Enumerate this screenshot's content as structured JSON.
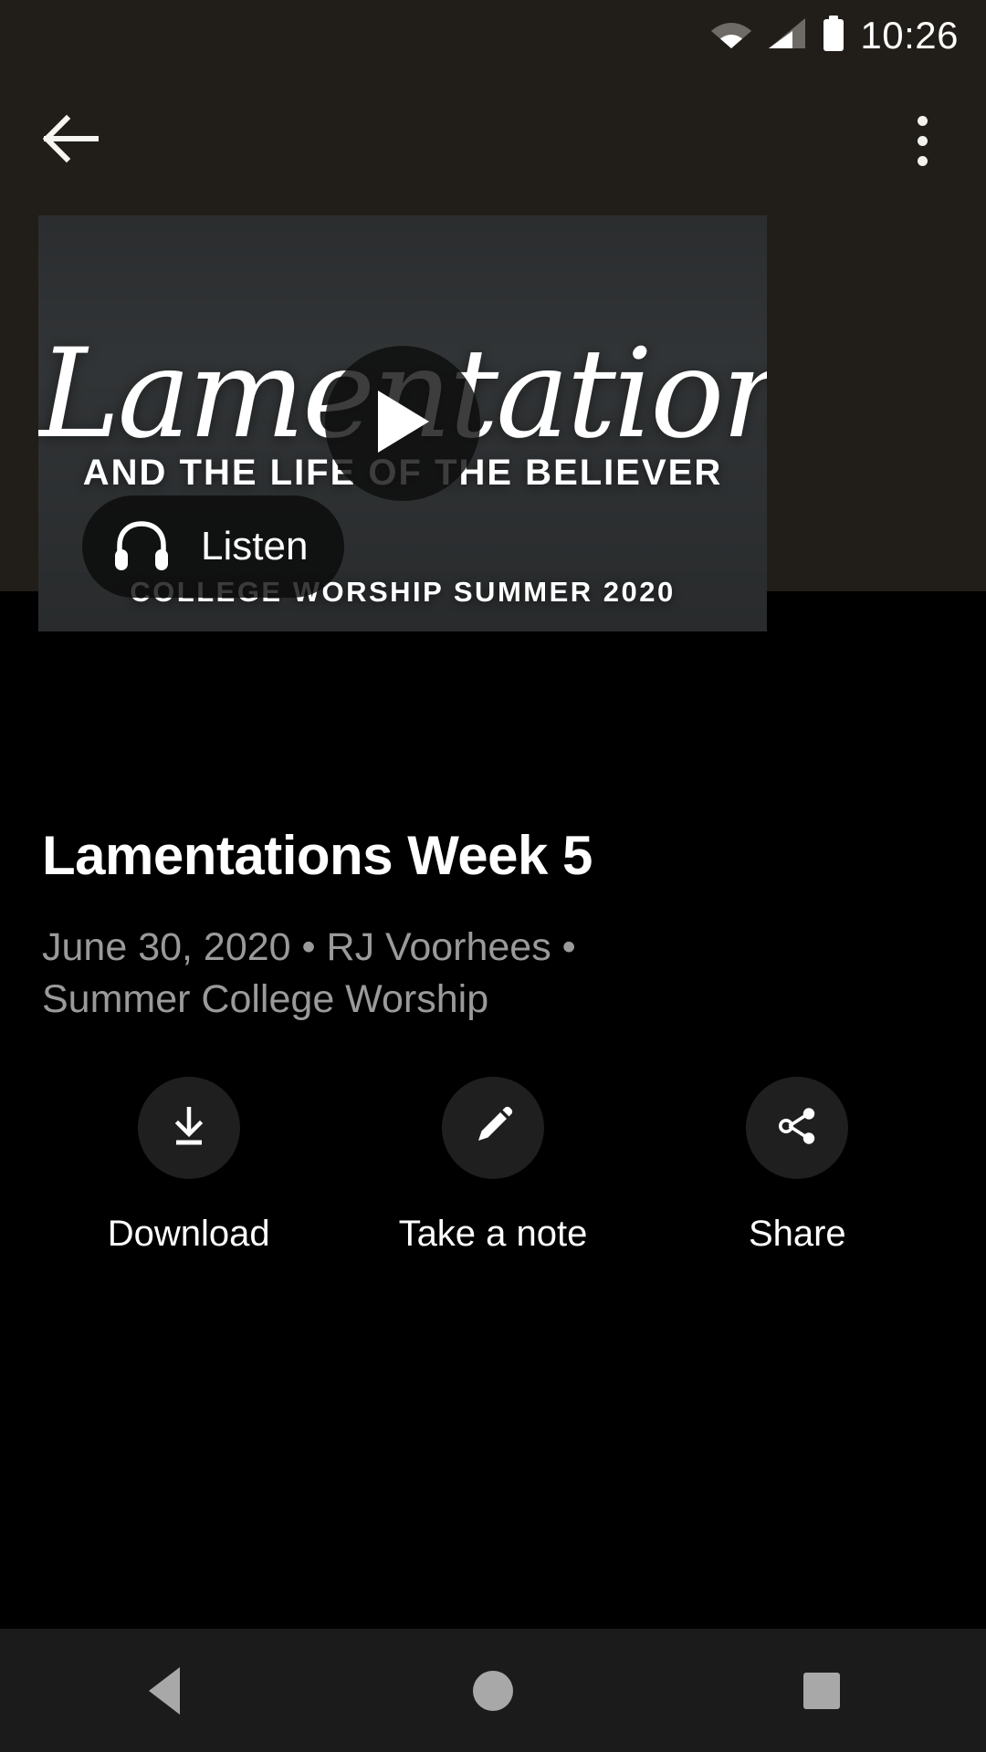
{
  "status_bar": {
    "time": "10:26",
    "icons": [
      "wifi-icon",
      "cellular-signal-icon",
      "battery-icon"
    ]
  },
  "app_bar": {
    "back_icon": "back-arrow-icon",
    "overflow_icon": "overflow-menu-icon"
  },
  "media": {
    "play_icon": "play-icon",
    "listen_label": "Listen",
    "listen_icon": "headphones-icon",
    "artwork": {
      "title_script": "Lamentations",
      "subtitle": "AND THE LIFE OF THE BELIEVER",
      "series_line": "COLLEGE WORSHIP SUMMER 2020"
    }
  },
  "details": {
    "title": "Lamentations Week 5",
    "meta": "June 30, 2020 • RJ Voorhees • Summer College Worship"
  },
  "actions": [
    {
      "label": "Download",
      "icon": "download-icon"
    },
    {
      "label": "Take a note",
      "icon": "pencil-icon"
    },
    {
      "label": "Share",
      "icon": "share-icon"
    }
  ],
  "nav_bar": {
    "back_label": "Back",
    "home_label": "Home",
    "recents_label": "Recents"
  },
  "colors": {
    "app_bar_bg": "#211e1a",
    "page_bg": "#000000",
    "text_primary": "#ffffff",
    "text_secondary": "#9a9a9a",
    "action_circle_bg": "#1f1f1f",
    "nav_bar_bg": "#1b1b1b"
  }
}
